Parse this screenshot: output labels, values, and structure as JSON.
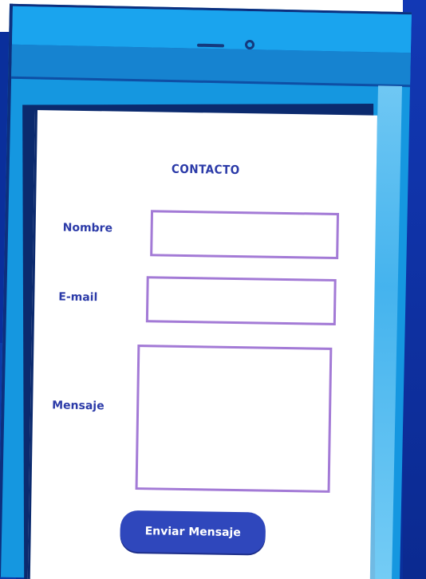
{
  "form": {
    "title": "CONTACTO",
    "name_label": "Nombre",
    "name_value": "",
    "email_label": "E-mail",
    "email_value": "",
    "message_label": "Mensaje",
    "message_value": "",
    "submit_label": "Enviar Mensaje"
  },
  "icons": {
    "speaker": "speaker-slot-icon",
    "camera": "front-camera-icon"
  },
  "colors": {
    "phone_body": "#1597e0",
    "text_accent": "#2b3aa8",
    "field_border": "#a37ad6",
    "button_bg": "#2f47bc",
    "background": "#0a2f9c"
  }
}
